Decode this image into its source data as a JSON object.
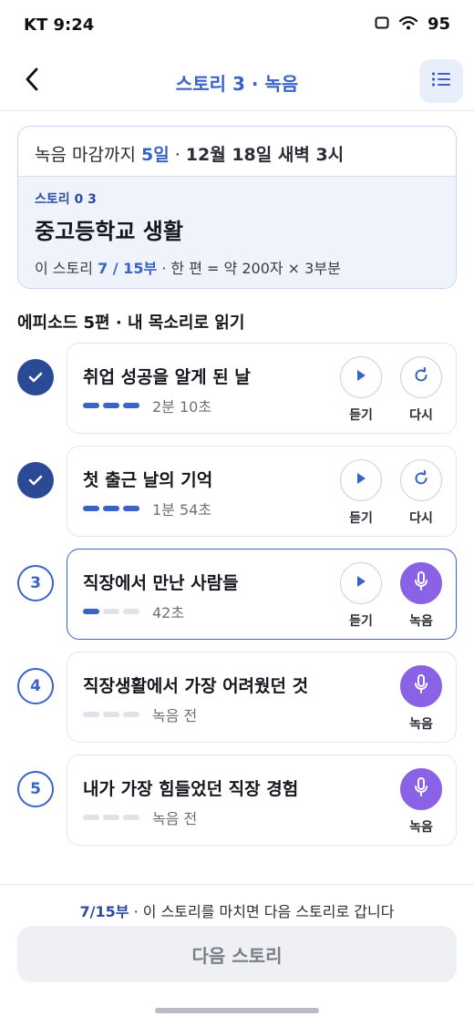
{
  "status_bar": {
    "carrier": "KT 9:24",
    "battery": "95"
  },
  "nav": {
    "title": "스토리 3 · 녹음"
  },
  "info": {
    "deadline_prefix": "녹음 마감까지 ",
    "deadline_days": "5일",
    "deadline_sep": " · ",
    "deadline_date": "12월 18일 새벽 3시",
    "story_tag": "스토리 0 3",
    "story_title": "중고등학교 생활",
    "meta_prefix": "이 스토리 ",
    "meta_progress": "7 / 15부",
    "meta_suffix": " · 한 편 = 약 200자 × 3부분"
  },
  "section_title": "에피소드 5편 · 내 목소리로 읽기",
  "episodes": [
    {
      "marker": "",
      "title": "취업 성공을 알게 된 날",
      "status": "2분 10초",
      "parts_done": 3,
      "listen_label": "듣기",
      "redo_label": "다시"
    },
    {
      "marker": "",
      "title": "첫 출근 날의 기억",
      "status": "1분 54초",
      "parts_done": 3,
      "listen_label": "듣기",
      "redo_label": "다시"
    },
    {
      "marker": "3",
      "title": "직장에서 만난 사람들",
      "status": "42초",
      "parts_done": 1,
      "listen_label": "듣기",
      "record_label": "녹음"
    },
    {
      "marker": "4",
      "title": "직장생활에서 가장 어려웠던 것",
      "status": "녹음 전",
      "parts_done": 0,
      "record_label": "녹음"
    },
    {
      "marker": "5",
      "title": "내가 가장 힘들었던 직장 경험",
      "status": "녹음 전",
      "parts_done": 0,
      "record_label": "녹음"
    }
  ],
  "footer": {
    "note_progress": "7/15부",
    "note_text": " · 이 스토리를 마치면 다음 스토리로 갑니다",
    "next_label": "다음 스토리"
  },
  "colors": {
    "accent": "#3a63c8",
    "done": "#2b4a96",
    "record": "#8a62e6",
    "muted": "#dfe2e8"
  },
  "icons": {
    "back": "chevron-left-icon",
    "menu": "list-icon",
    "check": "check-icon",
    "play": "play-icon",
    "redo": "refresh-icon",
    "mic": "microphone-icon"
  }
}
